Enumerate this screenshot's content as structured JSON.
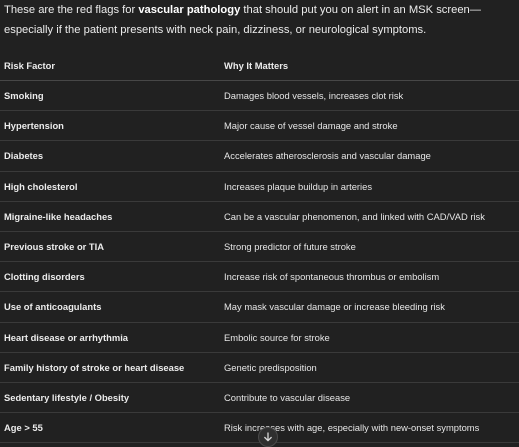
{
  "intro": {
    "pre": "These are the red flags for ",
    "bold": "vascular pathology",
    "post": " that should put you on alert in an MSK screen—especially if the patient presents with neck pain, dizziness, or neurological symptoms."
  },
  "table": {
    "headers": [
      "Risk Factor",
      "Why It Matters"
    ],
    "rows": [
      [
        "Smoking",
        "Damages blood vessels, increases clot risk"
      ],
      [
        "Hypertension",
        "Major cause of vessel damage and stroke"
      ],
      [
        "Diabetes",
        "Accelerates atherosclerosis and vascular damage"
      ],
      [
        "High cholesterol",
        "Increases plaque buildup in arteries"
      ],
      [
        "Migraine-like headaches",
        "Can be a vascular phenomenon, and linked with CAD/VAD risk"
      ],
      [
        "Previous stroke or TIA",
        "Strong predictor of future stroke"
      ],
      [
        "Clotting disorders",
        "Increase risk of spontaneous thrombus or embolism"
      ],
      [
        "Use of anticoagulants",
        "May mask vascular damage or increase bleeding risk"
      ],
      [
        "Heart disease or arrhythmia",
        "Embolic source for stroke"
      ],
      [
        "Family history of stroke or heart disease",
        "Genetic predisposition"
      ],
      [
        "Sedentary lifestyle / Obesity",
        "Contribute to vascular disease"
      ],
      [
        "Age > 55",
        "Risk increases with age, especially with new-onset symptoms"
      ]
    ]
  },
  "scroll_down": {
    "icon": "arrow-down-icon"
  }
}
